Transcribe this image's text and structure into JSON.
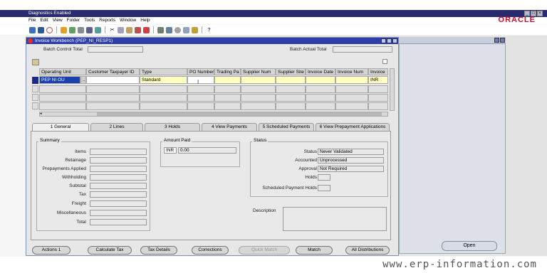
{
  "app": {
    "title": "Diagnostics Enabled",
    "brand": "ORACLE"
  },
  "menu": [
    "File",
    "Edit",
    "View",
    "Folder",
    "Tools",
    "Reports",
    "Window",
    "Help"
  ],
  "toolbar_icons": [
    "open-icon",
    "navigate-icon",
    "zoom-icon",
    "save-icon",
    "new-icon",
    "find-icon",
    "print-icon",
    "attach-icon",
    "cut-icon",
    "copy-icon",
    "paste-icon",
    "clear-icon",
    "delete-icon",
    "edit-icon",
    "translate-icon",
    "folder-icon",
    "help-icon"
  ],
  "invoice_window": {
    "title": "Invoice Workbench (PEP_NI_RESP1)",
    "batch_control_total_label": "Batch Control Total",
    "batch_actual_total_label": "Batch Actual Total",
    "columns": [
      "Operating Unit",
      "Customer Taxpayer ID",
      "Type",
      "PO Number",
      "Trading Pa",
      "Supplier Num",
      "Supplier Site",
      "Invoice Date",
      "Invoice Num",
      "Invoice"
    ],
    "row1": {
      "operating_unit": "PEP NI OU",
      "ellipsis": "...",
      "type": "Standard",
      "currency": "INR"
    },
    "tabs": [
      "1 General",
      "2 Lines",
      "3 Holds",
      "4 View Payments",
      "5 Scheduled Payments",
      "6 View Prepayment Applications"
    ],
    "summary": {
      "title": "Summary",
      "labels": [
        "Items",
        "Retainage",
        "Prepayments Applied",
        "Withholding",
        "Subtotal",
        "Tax",
        "Freight",
        "Miscellaneous",
        "Total"
      ]
    },
    "amount_paid": {
      "title": "Amount Paid",
      "currency": "INR",
      "value": "0.00"
    },
    "status": {
      "title": "Status",
      "status_label": "Status",
      "status_value": "Never Validated",
      "accounted_label": "Accounted",
      "accounted_value": "Unprocessed",
      "approval_label": "Approval",
      "approval_value": "Not Required",
      "holds_label": "Holds",
      "scheduled_label": "Scheduled Payment Holds"
    },
    "description_label": "Description",
    "buttons": {
      "actions": "Actions  1",
      "calculate_tax": "Calculate Tax",
      "tax_details": "Tax Details",
      "corrections": "Corrections",
      "quick_match": "Quick Match",
      "match": "Match",
      "all_distributions": "All Distributions"
    }
  },
  "background_window": {
    "open": "Open"
  },
  "watermark": "www.erp-information.com",
  "colors": {
    "title_bar": "#2e3fa8",
    "required_field": "#ffffc0",
    "oracle_red": "#c8102e"
  }
}
